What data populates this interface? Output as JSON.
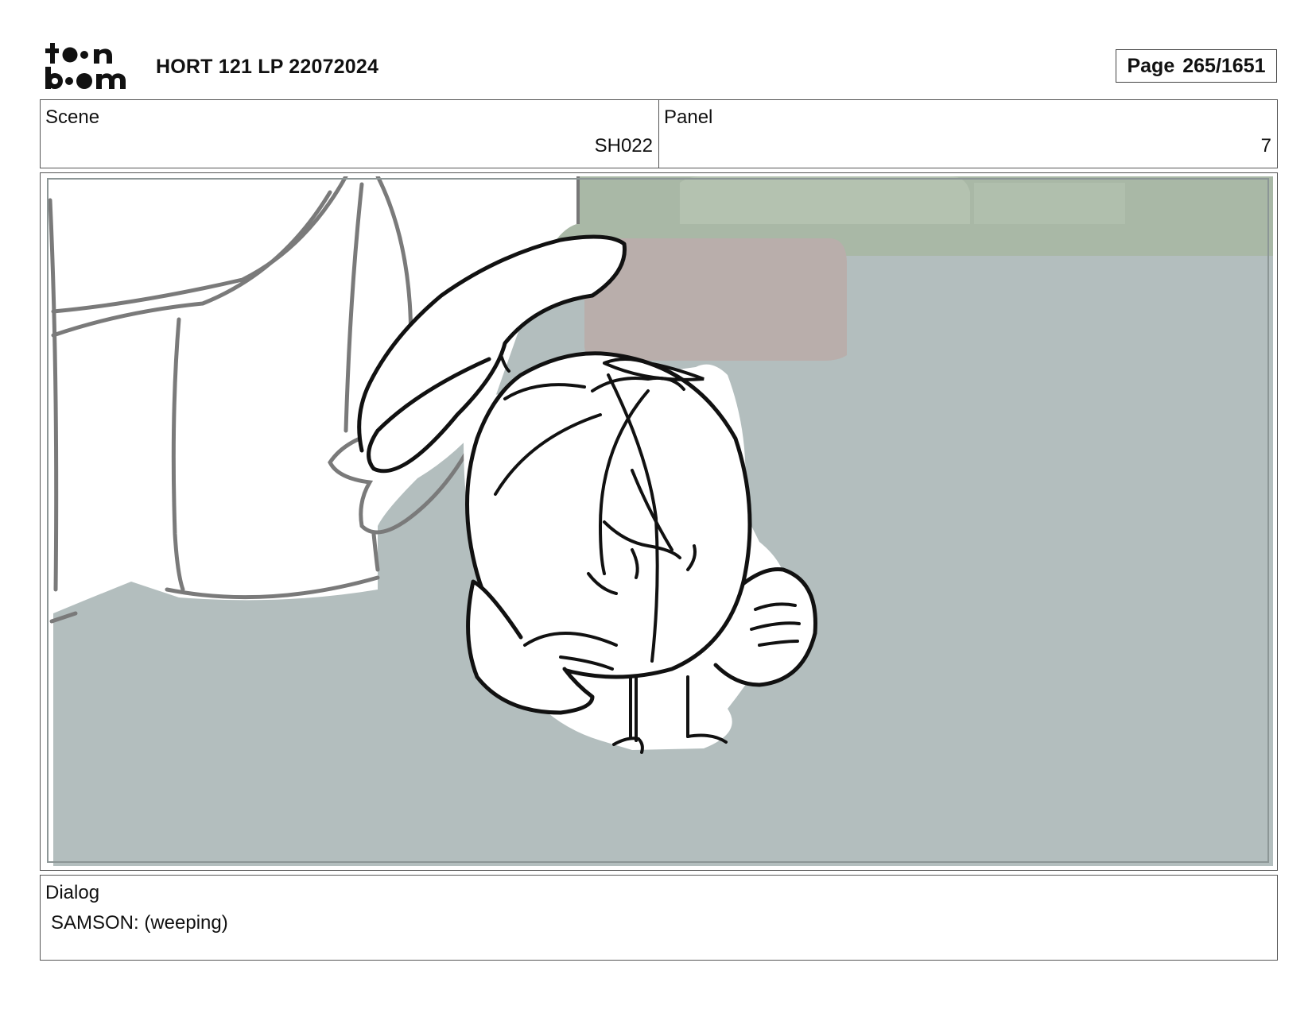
{
  "header": {
    "logo_text": "toon boom",
    "project_title": "HORT 121 LP 22072024",
    "page_label": "Page",
    "page_number": "265/1651"
  },
  "fields": {
    "scene_label": "Scene",
    "scene_value": "SH022",
    "panel_label": "Panel",
    "panel_value": "7"
  },
  "dialog": {
    "label": "Dialog",
    "text": "SAMSON: (weeping)"
  },
  "colors": {
    "floor": "#b3bebe",
    "wall": "#a9b8a6",
    "bowl": "#b9aeab",
    "line": "#111111",
    "rough_line": "#7a7a7a"
  }
}
